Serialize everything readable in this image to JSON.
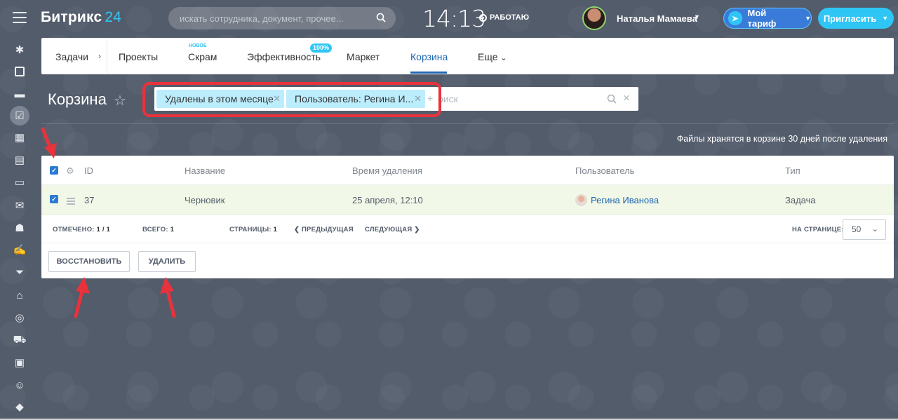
{
  "header": {
    "logo_text": "Битрикс",
    "logo_num": "24",
    "search_placeholder": "искать сотрудника, документ, прочее...",
    "time": "14:13",
    "work_status": "РАБОТАЮ",
    "user_name": "Наталья Мамаева",
    "tariff_label": "Мой тариф",
    "invite_label": "Пригласить"
  },
  "topmenu": {
    "items": [
      "Задачи",
      "Проекты",
      "Скрам",
      "Эффективность",
      "Маркет",
      "Корзина",
      "Еще"
    ],
    "new_label": "НОВОЕ",
    "efficiency_badge": "100%",
    "active": "Корзина"
  },
  "page": {
    "title": "Корзина",
    "filter_chips": [
      "Удалены в этом месяце",
      "Пользователь: Регина И..."
    ],
    "filter_placeholder": "оиск",
    "storage_note": "Файлы хранятся в корзине 30 дней после удаления"
  },
  "grid": {
    "columns": [
      "ID",
      "Название",
      "Время удаления",
      "Пользователь",
      "Тип"
    ],
    "rows": [
      {
        "id": "37",
        "name": "Черновик",
        "deleted": "25 апреля, 12:10",
        "user": "Регина Иванова",
        "type": "Задача"
      }
    ],
    "pager": {
      "selected_label": "ОТМЕЧЕНО:",
      "selected_value": "1 / 1",
      "total_label": "ВСЕГО:",
      "total_value": "1",
      "pages_label": "СТРАНИЦЫ:",
      "pages_value": "1",
      "prev_label": "ПРЕДЫДУЩАЯ",
      "next_label": "СЛЕДУЮЩАЯ",
      "per_page_label": "НА СТРАНИЦЕ:",
      "per_page_value": "50"
    },
    "restore_label": "ВОССТАНОВИТЬ",
    "delete_label": "УДАЛИТЬ"
  },
  "colors": {
    "accent": "#2fc6f6",
    "active_tab": "#2067b0",
    "highlight": "#e8323c",
    "chip": "#bcedfc",
    "selected_row": "#f1f8e8"
  }
}
